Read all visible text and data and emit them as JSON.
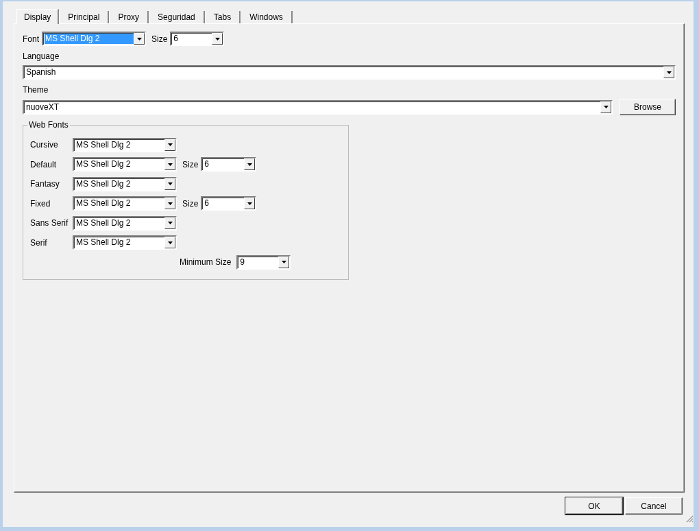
{
  "tabs": [
    {
      "label": "Display",
      "selected": true
    },
    {
      "label": "Principal",
      "selected": false
    },
    {
      "label": "Proxy",
      "selected": false
    },
    {
      "label": "Seguridad",
      "selected": false
    },
    {
      "label": "Tabs",
      "selected": false
    },
    {
      "label": "Windows",
      "selected": false
    }
  ],
  "font": {
    "label": "Font",
    "value": "MS Shell Dlg 2",
    "highlighted": true
  },
  "size": {
    "label": "Size",
    "value": "6"
  },
  "language": {
    "label": "Language",
    "value": "Spanish"
  },
  "theme": {
    "label": "Theme",
    "value": "nuoveXT",
    "browse": "Browse"
  },
  "web_fonts": {
    "title": "Web Fonts",
    "rows": [
      {
        "label": "Cursive",
        "value": "MS Shell Dlg 2"
      },
      {
        "label": "Default",
        "value": "MS Shell Dlg 2",
        "size": {
          "label": "Size",
          "value": "6"
        }
      },
      {
        "label": "Fantasy",
        "value": "MS Shell Dlg 2"
      },
      {
        "label": "Fixed",
        "value": "MS Shell Dlg 2",
        "size": {
          "label": "Size",
          "value": "6"
        }
      },
      {
        "label": "Sans Serif",
        "value": "MS Shell Dlg 2"
      },
      {
        "label": "Serif",
        "value": "MS Shell Dlg 2"
      }
    ],
    "minimum_size": {
      "label": "Minimum Size",
      "value": "9"
    }
  },
  "buttons": [
    {
      "label": "OK",
      "default": true
    },
    {
      "label": "Cancel",
      "default": false
    }
  ]
}
